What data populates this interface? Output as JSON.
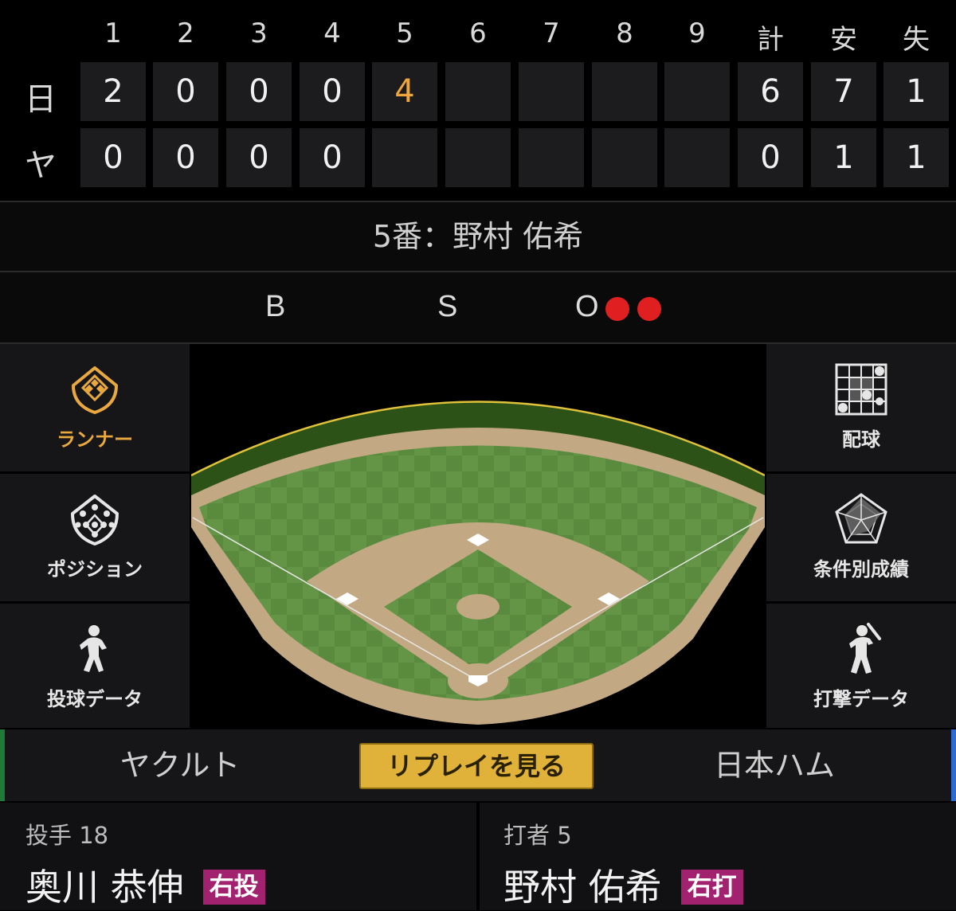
{
  "scoreboard": {
    "headers": [
      "1",
      "2",
      "3",
      "4",
      "5",
      "6",
      "7",
      "8",
      "9",
      "計",
      "安",
      "失"
    ],
    "teams": [
      {
        "abbr": "日",
        "innings": [
          "2",
          "0",
          "0",
          "0",
          "4",
          "",
          "",
          "",
          ""
        ],
        "totals": [
          "6",
          "7",
          "1"
        ]
      },
      {
        "abbr": "ヤ",
        "innings": [
          "0",
          "0",
          "0",
          "0",
          "",
          "",
          "",
          "",
          ""
        ],
        "totals": [
          "0",
          "1",
          "1"
        ]
      }
    ]
  },
  "current_batter_line": "5番：野村 佑希",
  "count": {
    "ball_label": "B",
    "strike_label": "S",
    "out_label": "O",
    "balls": 0,
    "strikes": 0,
    "outs": 2
  },
  "colors": {
    "accent": "#e9a93e",
    "live_inning": "#f0a63c",
    "out_dot": "#e02020",
    "badge": "#a3226f",
    "replay": "#e0b23a"
  },
  "left_menu": [
    {
      "label": "ランナー",
      "icon": "runner-diamond-icon",
      "active": true
    },
    {
      "label": "ポジション",
      "icon": "position-icon",
      "active": false
    },
    {
      "label": "投球データ",
      "icon": "pitcher-icon",
      "active": false
    }
  ],
  "right_menu": [
    {
      "label": "配球",
      "icon": "pitch-grid-icon"
    },
    {
      "label": "条件別成績",
      "icon": "radar-chart-icon"
    },
    {
      "label": "打撃データ",
      "icon": "batter-icon"
    }
  ],
  "tabs": {
    "left": "ヤクルト",
    "replay": "リプレイを見る",
    "right": "日本ハム"
  },
  "pitcher": {
    "role": "投手 18",
    "name": "奥川 恭伸",
    "hand": "右投"
  },
  "batter": {
    "role": "打者 5",
    "name": "野村 佑希",
    "hand": "右打"
  }
}
